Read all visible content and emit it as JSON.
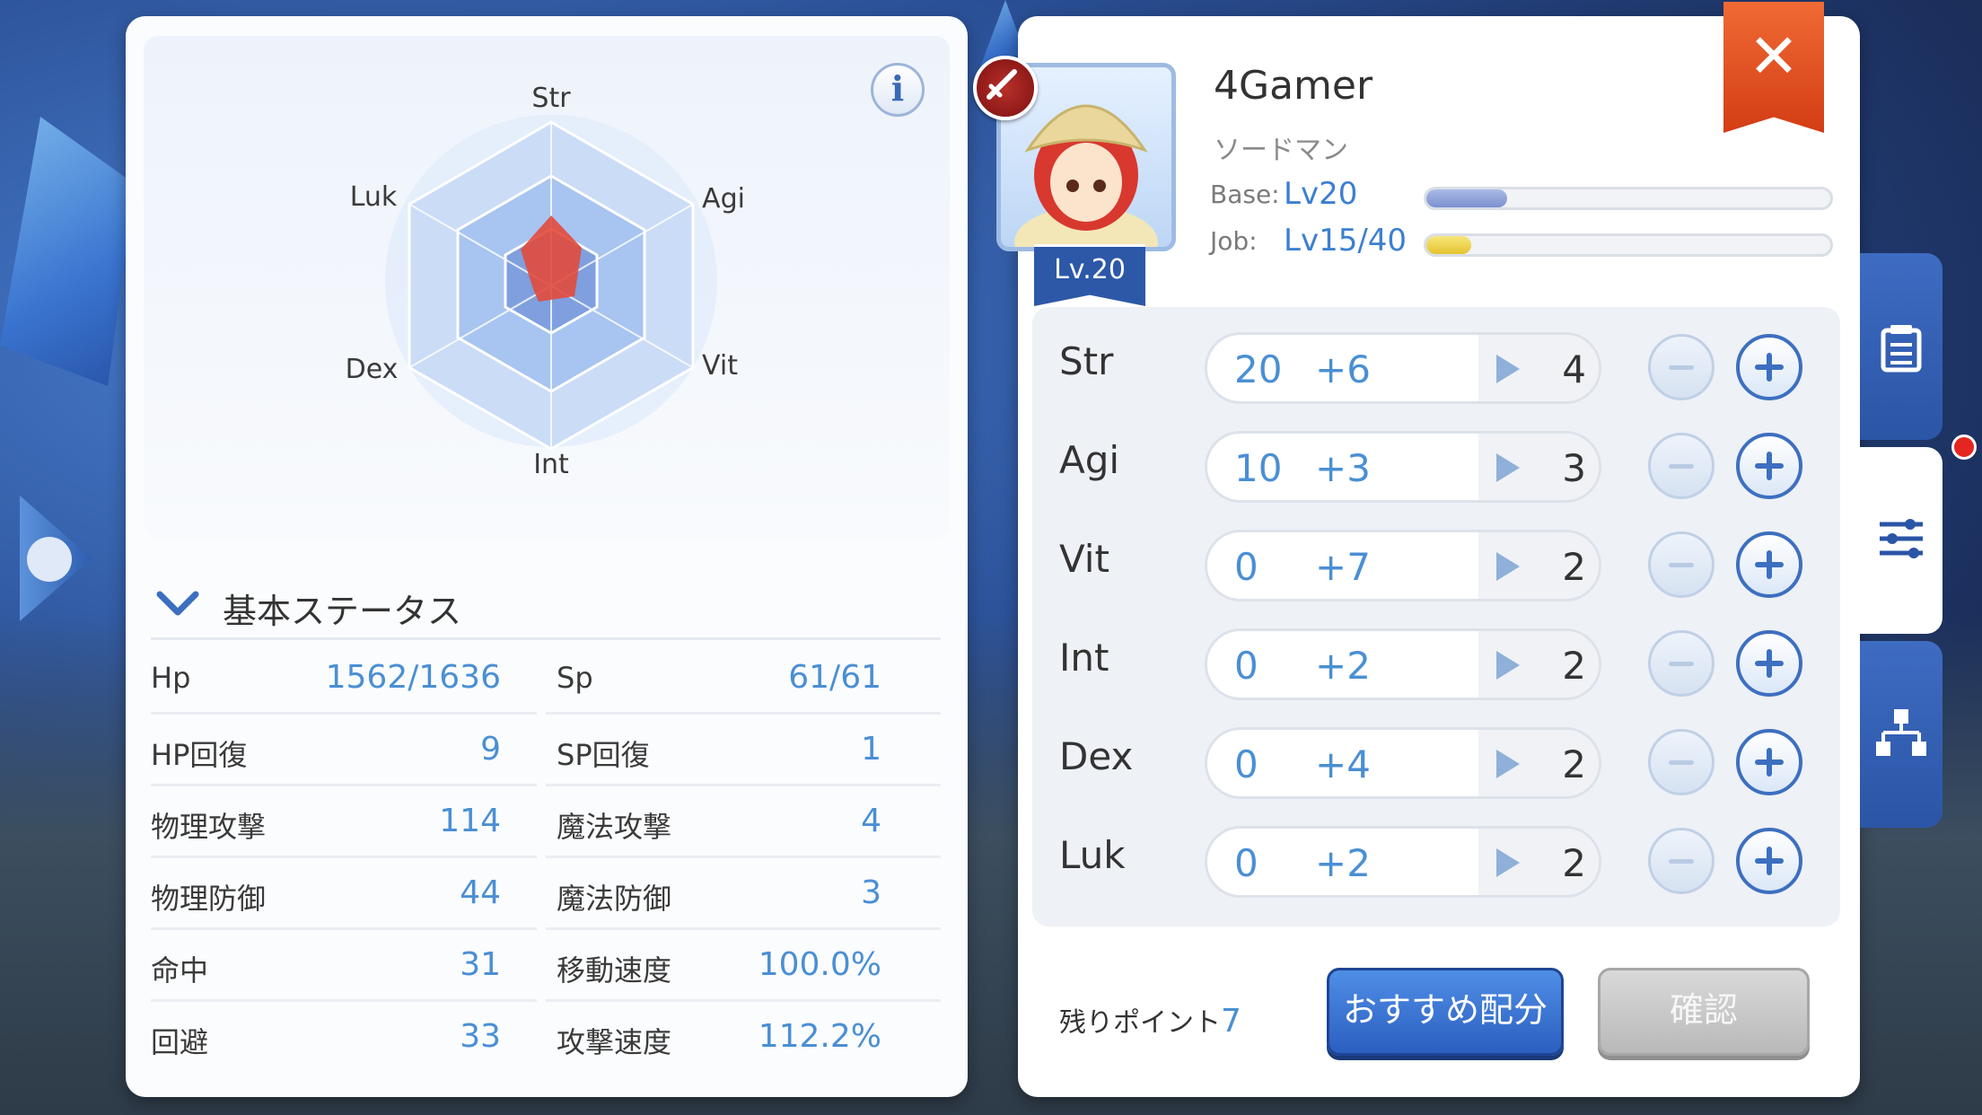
{
  "radar": {
    "labels": {
      "str": "Str",
      "agi": "Agi",
      "vit": "Vit",
      "int": "Int",
      "dex": "Dex",
      "luk": "Luk"
    }
  },
  "info_button": {
    "label": "i"
  },
  "section": {
    "title": "基本ステータス"
  },
  "stats": [
    {
      "left": {
        "name": "Hp",
        "value": "1562/1636"
      },
      "right": {
        "name": "Sp",
        "value": "61/61"
      }
    },
    {
      "left": {
        "name": "HP回復",
        "value": "9"
      },
      "right": {
        "name": "SP回復",
        "value": "1"
      }
    },
    {
      "left": {
        "name": "物理攻撃",
        "value": "114"
      },
      "right": {
        "name": "魔法攻撃",
        "value": "4"
      }
    },
    {
      "left": {
        "name": "物理防御",
        "value": "44"
      },
      "right": {
        "name": "魔法防御",
        "value": "3"
      }
    },
    {
      "left": {
        "name": "命中",
        "value": "31"
      },
      "right": {
        "name": "移動速度",
        "value": "100.0%"
      }
    },
    {
      "left": {
        "name": "回避",
        "value": "33"
      },
      "right": {
        "name": "攻撃速度",
        "value": "112.2%"
      }
    }
  ],
  "character": {
    "name": "4Gamer",
    "class": "ソードマン",
    "level_badge": "Lv.20",
    "base_label": "Base:",
    "base_level": "Lv20",
    "base_progress": 0.2,
    "job_label": "Job:",
    "job_level": "Lv15/40",
    "job_progress": 0.11
  },
  "close_button": {
    "label": "✕"
  },
  "allocation": [
    {
      "name": "Str",
      "base": "20",
      "bonus": "+6",
      "cost": "4"
    },
    {
      "name": "Agi",
      "base": "10",
      "bonus": "+3",
      "cost": "3"
    },
    {
      "name": "Vit",
      "base": "0",
      "bonus": "+7",
      "cost": "2"
    },
    {
      "name": "Int",
      "base": "0",
      "bonus": "+2",
      "cost": "2"
    },
    {
      "name": "Dex",
      "base": "0",
      "bonus": "+4",
      "cost": "2"
    },
    {
      "name": "Luk",
      "base": "0",
      "bonus": "+2",
      "cost": "2"
    }
  ],
  "footer": {
    "remaining_label": "残りポイント",
    "remaining_value": "7",
    "recommend_label": "おすすめ配分",
    "confirm_label": "確認"
  },
  "colors": {
    "accent": "#4a8fd4",
    "radar_fill": "#e24a3c",
    "close": "#e24f22",
    "nav_blue": "#2b55a6"
  }
}
